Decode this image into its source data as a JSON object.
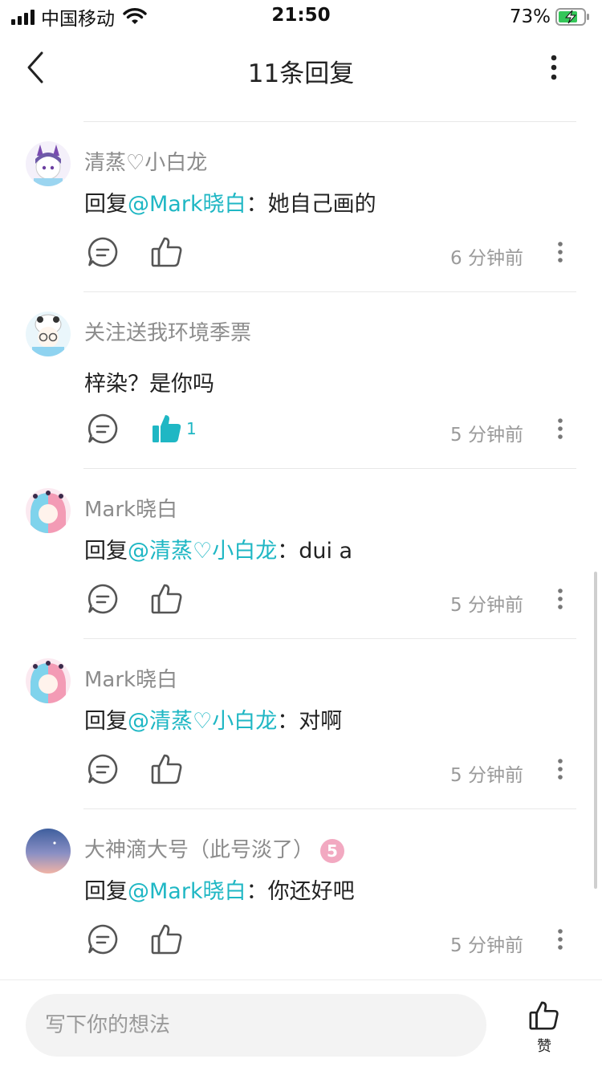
{
  "status_bar": {
    "carrier": "中国移动",
    "time": "21:50",
    "battery_percent": "73%",
    "charging": true
  },
  "header": {
    "title": "11条回复",
    "back_icon": "chevron-left-icon",
    "more_icon": "more-vertical-icon"
  },
  "comments": [
    {
      "author": "清蒸♡小白龙",
      "reply_prefix": "回复",
      "mention": "@Mark晓白",
      "separator": "：",
      "text": "她自己画的",
      "time": "6 分钟前",
      "liked": false,
      "like_count": ""
    },
    {
      "author": "关注送我环境季票",
      "reply_prefix": "",
      "mention": "",
      "separator": "",
      "text": "梓染？是你吗",
      "time": "5 分钟前",
      "liked": true,
      "like_count": "1"
    },
    {
      "author": "Mark晓白",
      "reply_prefix": "回复",
      "mention": "@清蒸♡小白龙",
      "separator": "：",
      "text": "dui a",
      "time": "5 分钟前",
      "liked": false,
      "like_count": ""
    },
    {
      "author": "Mark晓白",
      "reply_prefix": "回复",
      "mention": "@清蒸♡小白龙",
      "separator": "：",
      "text": "对啊",
      "time": "5 分钟前",
      "liked": false,
      "like_count": ""
    },
    {
      "author": "大神滴大号（此号淡了）",
      "badge": "5",
      "reply_prefix": "回复",
      "mention": "@Mark晓白",
      "separator": "：",
      "text": "你还好吧",
      "time": "5 分钟前",
      "liked": false,
      "like_count": ""
    }
  ],
  "bottom_bar": {
    "input_placeholder": "写下你的想法",
    "like_label": "赞"
  },
  "colors": {
    "accent": "#1fb7c4",
    "meta_text": "#9a9a9a",
    "divider": "#e8e8e8"
  }
}
